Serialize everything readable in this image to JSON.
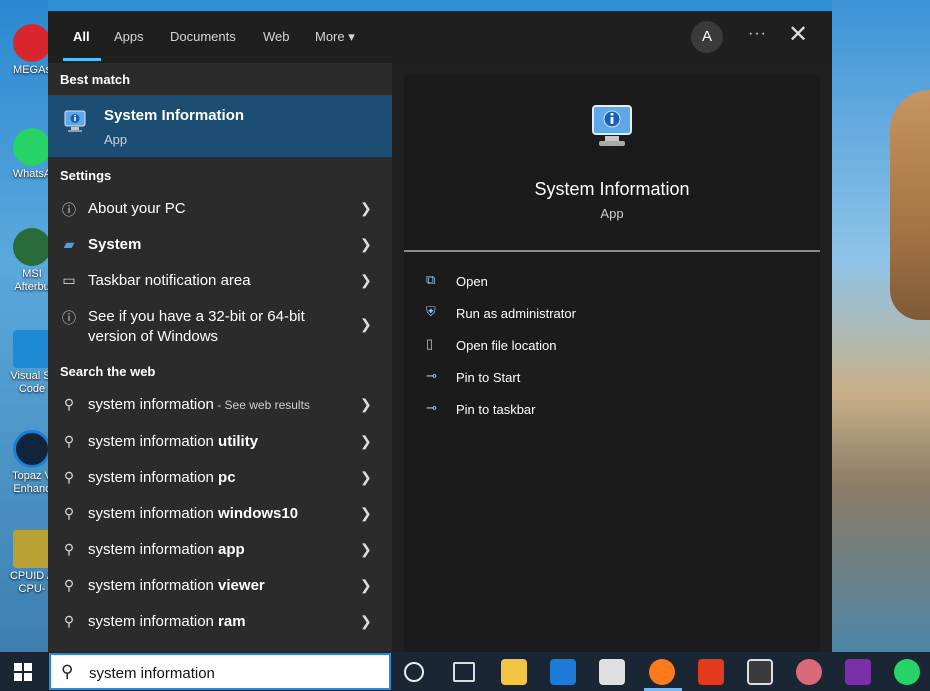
{
  "desktop": {
    "icons": [
      "MEGAs",
      "WhatsA",
      "MSI\nAfterbu",
      "Visual St\nCode",
      "Topaz V\nEnhanc",
      "CPUID A\nCPU-"
    ]
  },
  "menu": {
    "tabs": [
      "All",
      "Apps",
      "Documents",
      "Web",
      "More ▾"
    ],
    "avatar": "A",
    "more_options": "···",
    "close": "✕",
    "best_match": {
      "header": "Best match",
      "title": "System Information",
      "subtitle": "App"
    },
    "settings": {
      "header": "Settings",
      "items": [
        "About your PC",
        "System",
        "Taskbar notification area",
        "See if you have a 32-bit or 64-bit\nversion of Windows"
      ]
    },
    "web": {
      "header": "Search the web",
      "items": [
        {
          "prefix": "system information",
          "bold": "",
          "suffix": " - See web results"
        },
        {
          "prefix": "system information ",
          "bold": "utility",
          "suffix": ""
        },
        {
          "prefix": "system information ",
          "bold": "pc",
          "suffix": ""
        },
        {
          "prefix": "system information ",
          "bold": "windows10",
          "suffix": ""
        },
        {
          "prefix": "system information ",
          "bold": "app",
          "suffix": ""
        },
        {
          "prefix": "system information ",
          "bold": "viewer",
          "suffix": ""
        },
        {
          "prefix": "system information ",
          "bold": "ram",
          "suffix": ""
        }
      ]
    },
    "preview": {
      "title": "System Information",
      "subtitle": "App",
      "actions": [
        "Open",
        "Run as administrator",
        "Open file location",
        "Pin to Start",
        "Pin to taskbar"
      ]
    }
  },
  "taskbar": {
    "search_value": "system information",
    "apps": [
      "cortana-icon",
      "task-view-icon",
      "file-explorer-icon",
      "mail-icon",
      "store-icon",
      "firefox-icon",
      "office-icon",
      "video-editor-icon",
      "snipping-icon",
      "onenote-icon",
      "whatsapp-icon"
    ]
  }
}
